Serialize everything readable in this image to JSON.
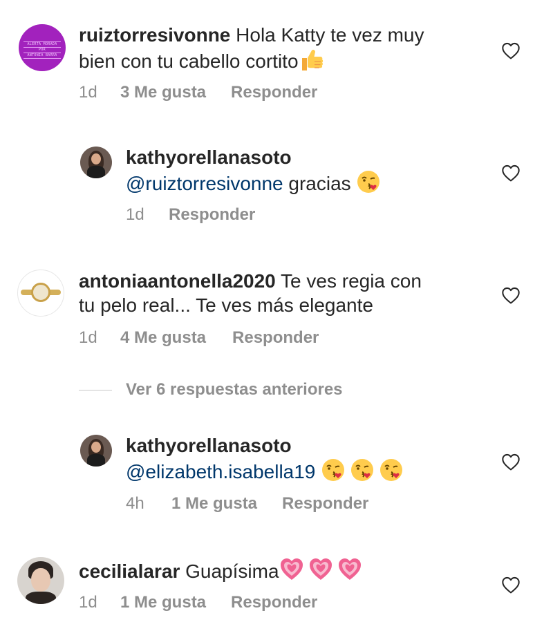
{
  "comments": [
    {
      "username": "ruiztorresivonne",
      "text_line1": " Hola Katty te vez muy",
      "text_line2": "bien con tu cabello cortito",
      "time": "1d",
      "likes": "3 Me gusta",
      "reply": "Responder",
      "avatar_text_top": "ALERTA MORADA",
      "avatar_text_mid": "POR",
      "avatar_text_bottom": "ANTONIA BARRA"
    },
    {
      "username": "kathyorellanasoto",
      "mention": "@ruiztorresivonne",
      "text": " gracias ",
      "time": "1d",
      "reply": "Responder"
    },
    {
      "username": "antoniaantonella2020",
      "text_line1": " Te ves regia con",
      "text_line2": "tu pelo real... Te ves más elegante",
      "time": "1d",
      "likes": "4 Me gusta",
      "reply": "Responder"
    },
    {
      "username": "kathyorellanasoto",
      "mention": "@elizabeth.isabella19",
      "time": "4h",
      "likes": "1 Me gusta",
      "reply": "Responder"
    },
    {
      "username": "cecilialarar",
      "text": " Guapísima",
      "time": "1d",
      "likes": "1 Me gusta",
      "reply": "Responder"
    }
  ],
  "view_previous": "Ver 6 respuestas anteriores",
  "colors": {
    "text": "#262626",
    "muted": "#8e8e8e",
    "mention": "#00376b",
    "purple_avatar": "#a222bd",
    "heart_pink": "#f06292"
  },
  "icons": [
    "heart-outline-icon",
    "thumbs-up-emoji",
    "kissing-face-emoji",
    "pink-heart-emoji"
  ]
}
